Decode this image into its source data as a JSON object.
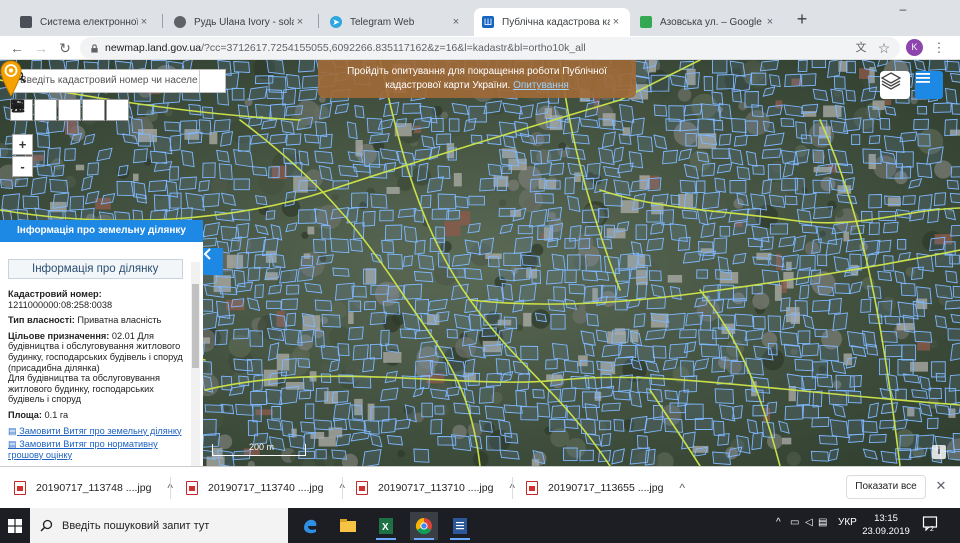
{
  "browser": {
    "tabs": [
      {
        "title": "Система електронної пош",
        "favicon_color": "#4b4f57",
        "active": false
      },
      {
        "title": "Рудь Ulaна Ivory - solarm",
        "favicon_color": "#5f6368",
        "active": false
      },
      {
        "title": "Telegram Web",
        "favicon_color": "#2ca5e0",
        "active": false
      },
      {
        "title": "Публічна кадастрова карт",
        "favicon_color": "#1565c0",
        "active": true
      },
      {
        "title": "Азовська ул. – Google Карт",
        "favicon_color": "#34a853",
        "active": false
      }
    ],
    "new_tab": "+",
    "window_controls": {
      "minimize": "–",
      "maximize": "□",
      "close": "✕"
    },
    "url_host": "newmap.land.gov.ua",
    "url_rest": "/?cc=3712617.7254155055,6092266.835117162&z=16&l=kadastr&bl=ortho10k_all",
    "profile_initial": "K"
  },
  "map": {
    "search_placeholder": "Введіть кадастровий номер чи населе",
    "zoom_in": "+",
    "zoom_out": "-",
    "survey_text": "Пройдіть опитування для покращення роботи Публічної кадастрової карти України.",
    "survey_link": "Опитування",
    "scale_label": "200 m",
    "info_icon": "i"
  },
  "panel": {
    "header": "Інформація про земельну ділянку",
    "subheader": "Інформація про ділянку",
    "cad_label": "Кадастровий номер:",
    "cad_value": "1211000000:08:258:0038",
    "ownership_label": "Тип власності:",
    "ownership_value": "Приватна власність",
    "purpose_label": "Цільове призначення:",
    "purpose_value": "02.01 Для будівництва і обслуговування житлового будинку, господарських будівель і споруд (присадибна ділянка)",
    "purpose_extra": "Для будівництва та обслуговування житлового будинку, господарських будівель і споруд",
    "area_label": "Площа:",
    "area_value": "0.1 га",
    "link1": "Замовити Витяг про земельну ділянку",
    "link2": "Замовити Витяг про нормативну грошову оцінку"
  },
  "downloads": {
    "items": [
      {
        "name": "20190717_113748 ....jpg"
      },
      {
        "name": "20190717_113740 ....jpg"
      },
      {
        "name": "20190717_113710 ....jpg"
      },
      {
        "name": "20190717_113655 ....jpg"
      }
    ],
    "show_all": "Показати все",
    "close": "✕"
  },
  "taskbar": {
    "search_placeholder": "Введіть пошуковий запит тут",
    "language": "УКР",
    "time": "13:15",
    "date": "23.09.2019",
    "notifications": "2"
  },
  "colors": {
    "accent": "#1e88e5",
    "parcel_stroke": "#7fb8ff",
    "road_stroke": "#c8e04a",
    "pin": "#f5a200",
    "survey_bg": "#a06937"
  }
}
